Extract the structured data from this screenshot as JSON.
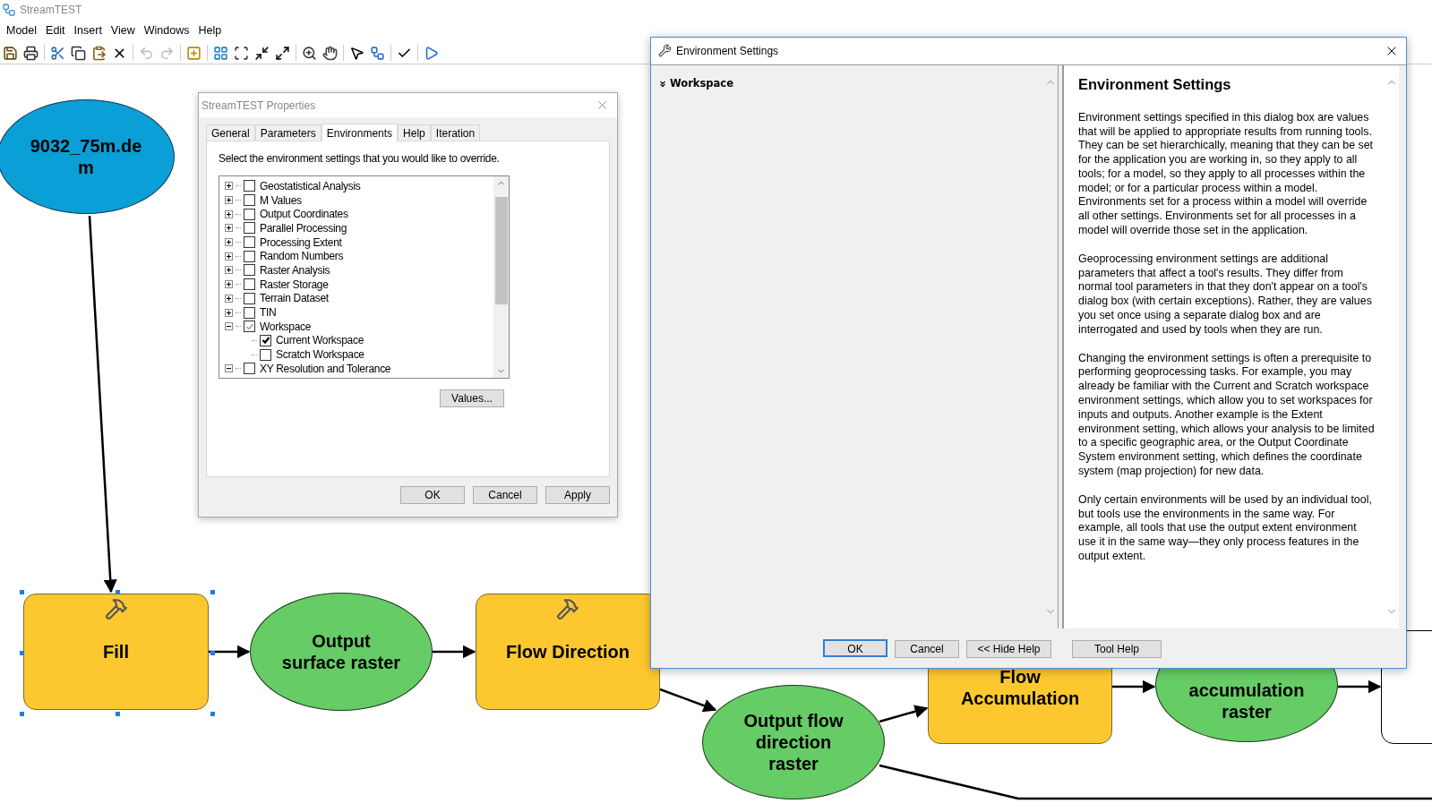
{
  "app": {
    "title": "StreamTEST"
  },
  "menu": [
    "Model",
    "Edit",
    "Insert",
    "View",
    "Windows",
    "Help"
  ],
  "toolbar": [
    {
      "kind": "save",
      "disabled": false
    },
    {
      "kind": "print",
      "disabled": false
    },
    {
      "kind": "cut",
      "disabled": false
    },
    {
      "kind": "copy",
      "disabled": false
    },
    {
      "kind": "paste",
      "disabled": false
    },
    {
      "kind": "delete",
      "disabled": false
    },
    {
      "kind": "undo",
      "disabled": true
    },
    {
      "kind": "redo",
      "disabled": true
    },
    {
      "kind": "add",
      "disabled": false
    },
    {
      "kind": "layout",
      "disabled": false
    },
    {
      "kind": "fit",
      "disabled": false
    },
    {
      "kind": "shrink",
      "disabled": false
    },
    {
      "kind": "expand",
      "disabled": false
    },
    {
      "kind": "zoom",
      "disabled": false
    },
    {
      "kind": "pan",
      "disabled": false
    },
    {
      "kind": "select",
      "disabled": false
    },
    {
      "kind": "connect",
      "disabled": false
    },
    {
      "kind": "validate",
      "disabled": false
    },
    {
      "kind": "run",
      "disabled": false
    }
  ],
  "model": {
    "nodes": [
      {
        "kind": "input",
        "label": "9032_75m.dem",
        "selected": false
      },
      {
        "kind": "tool",
        "label": "Fill",
        "selected": true
      },
      {
        "kind": "output",
        "label": "Output surface raster",
        "selected": false
      },
      {
        "kind": "tool",
        "label": "Flow Direction",
        "selected": false
      },
      {
        "kind": "output",
        "label": "Output flow direction raster",
        "selected": false
      },
      {
        "kind": "tool",
        "label": "Flow Accumulation",
        "selected": false
      },
      {
        "kind": "output",
        "label": "accumulation raster",
        "selected": false
      }
    ]
  },
  "properties_dialog": {
    "title": "StreamTEST Properties",
    "tabs": [
      {
        "label": "General",
        "selected": false
      },
      {
        "label": "Parameters",
        "selected": false
      },
      {
        "label": "Environments",
        "selected": true
      },
      {
        "label": "Help",
        "selected": false
      },
      {
        "label": "Iteration",
        "selected": false
      }
    ],
    "instruction": "Select the environment settings that you would like to override.",
    "tree": [
      {
        "label": "Geostatistical Analysis",
        "checked": false,
        "expanded": false
      },
      {
        "label": "M Values",
        "checked": false,
        "expanded": false
      },
      {
        "label": "Output Coordinates",
        "checked": false,
        "expanded": false
      },
      {
        "label": "Parallel Processing",
        "checked": false,
        "expanded": false
      },
      {
        "label": "Processing Extent",
        "checked": false,
        "expanded": false
      },
      {
        "label": "Random Numbers",
        "checked": false,
        "expanded": false
      },
      {
        "label": "Raster Analysis",
        "checked": false,
        "expanded": false
      },
      {
        "label": "Raster Storage",
        "checked": false,
        "expanded": false
      },
      {
        "label": "Terrain Dataset",
        "checked": false,
        "expanded": false
      },
      {
        "label": "TIN",
        "checked": false,
        "expanded": false
      },
      {
        "label": "Workspace",
        "checked": true,
        "partial": true,
        "expanded": true,
        "children": [
          {
            "label": "Current Workspace",
            "checked": true
          },
          {
            "label": "Scratch Workspace",
            "checked": false
          }
        ]
      },
      {
        "label": "XY Resolution and Tolerance",
        "checked": false,
        "expanded": true
      }
    ],
    "values_button": "Values...",
    "buttons": [
      "OK",
      "Cancel",
      "Apply"
    ]
  },
  "environment_dialog": {
    "title": "Environment Settings",
    "section": {
      "label": "Workspace",
      "expanded": true
    },
    "help_title": "Environment Settings",
    "help_paragraphs": [
      "Environment settings specified in this dialog box are values that will be applied to appropriate results from running tools. They can be set hierarchically, meaning that they can be set for the application you are working in, so they apply to all tools; for a model, so they apply to all processes within the model; or for a particular process within a model. Environments set for a process within a model will override all other settings. Environments set for all processes in a model will override those set in the application.",
      "Geoprocessing environment settings are additional parameters that affect a tool's results. They differ from normal tool parameters in that they don't appear on a tool's dialog box (with certain exceptions). Rather, they are values you set once using a separate dialog box and are interrogated and used by tools when they are run.",
      "Changing the environment settings is often a prerequisite to performing geoprocessing tasks. For example, you may already be familiar with the Current and Scratch workspace environment settings, which allow you to set workspaces for inputs and outputs. Another example is the Extent environment setting, which allows your analysis to be limited to a specific geographic area, or the Output Coordinate System environment setting, which defines the coordinate system (map projection) for new data.",
      "Only certain environments will be used by an individual tool, but tools use the environments in the same way. For example, all tools that use the output extent environment use it in the same way—they only process features in the output extent."
    ],
    "buttons": [
      {
        "label": "OK",
        "default": true
      },
      {
        "label": "Cancel",
        "default": false
      },
      {
        "label": "<< Hide Help",
        "default": false
      },
      {
        "label": "Tool Help",
        "default": false
      }
    ]
  }
}
